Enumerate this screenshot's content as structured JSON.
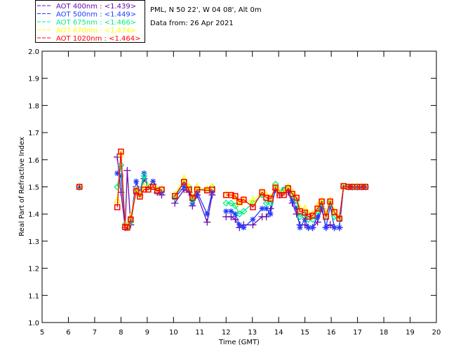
{
  "header": {
    "site_line": "PML, N 50 22', W 04 08', Alt 0m",
    "date_line": "Data from: 26 Apr 2021"
  },
  "chart_data": {
    "type": "line",
    "title": "",
    "xlabel": "Time (GMT)",
    "ylabel": "Real Part of Refractive Index",
    "xlim": [
      5,
      20
    ],
    "ylim": [
      1.0,
      2.0
    ],
    "xticks": [
      "5",
      "6",
      "7",
      "8",
      "9",
      "10",
      "11",
      "12",
      "13",
      "14",
      "15",
      "16",
      "17",
      "18",
      "19",
      "20"
    ],
    "yticks": [
      "1.0",
      "1.1",
      "1.2",
      "1.3",
      "1.4",
      "1.5",
      "1.6",
      "1.7",
      "1.8",
      "1.9",
      "2.0"
    ],
    "grid": false,
    "legend_placement": "top-left outside",
    "x": [
      6.42,
      7.86,
      8.0,
      8.16,
      8.24,
      8.37,
      8.58,
      8.72,
      8.88,
      9.04,
      9.22,
      9.38,
      9.55,
      10.05,
      10.4,
      10.59,
      10.72,
      10.9,
      11.28,
      11.47,
      12.0,
      12.19,
      12.35,
      12.51,
      12.67,
      13.02,
      13.37,
      13.53,
      13.69,
      13.88,
      14.04,
      14.2,
      14.36,
      14.52,
      14.68,
      14.81,
      15.0,
      15.13,
      15.29,
      15.48,
      15.64,
      15.8,
      15.96,
      16.12,
      16.31,
      16.47,
      16.66,
      16.8,
      16.99,
      17.16,
      17.3
    ],
    "series": [
      {
        "name": "AOT  400nm",
        "mean": "<1.439>",
        "color": "#6a0dad",
        "marker": "plus",
        "values": [
          1.5,
          1.61,
          1.48,
          1.35,
          1.56,
          1.36,
          1.5,
          1.47,
          1.53,
          1.5,
          1.51,
          1.48,
          1.47,
          1.44,
          1.49,
          1.48,
          1.43,
          1.47,
          1.37,
          1.47,
          1.39,
          1.39,
          1.38,
          1.35,
          1.36,
          1.36,
          1.39,
          1.39,
          1.42,
          1.49,
          1.47,
          1.48,
          1.48,
          1.44,
          1.4,
          1.36,
          1.36,
          1.35,
          1.35,
          1.37,
          1.42,
          1.35,
          1.36,
          1.35,
          1.35,
          1.5,
          1.5,
          1.5,
          1.5,
          1.5,
          1.5
        ]
      },
      {
        "name": "AOT  500nm",
        "mean": "<1.449>",
        "color": "#1e3cff",
        "marker": "asterisk",
        "values": [
          1.5,
          1.55,
          1.54,
          1.36,
          1.35,
          1.38,
          1.52,
          1.48,
          1.55,
          1.5,
          1.52,
          1.49,
          1.48,
          1.46,
          1.5,
          1.49,
          1.44,
          1.48,
          1.4,
          1.48,
          1.41,
          1.41,
          1.4,
          1.36,
          1.35,
          1.38,
          1.42,
          1.42,
          1.4,
          1.5,
          1.48,
          1.49,
          1.49,
          1.45,
          1.42,
          1.35,
          1.38,
          1.35,
          1.35,
          1.39,
          1.43,
          1.35,
          1.43,
          1.35,
          1.35,
          1.5,
          1.5,
          1.5,
          1.5,
          1.5,
          1.5
        ]
      },
      {
        "name": "AOT  675nm",
        "mean": "<1.466>",
        "color": "#00f080",
        "marker": "diamond",
        "values": [
          1.5,
          1.5,
          1.58,
          1.36,
          1.35,
          1.37,
          1.49,
          1.47,
          1.54,
          1.5,
          1.5,
          1.49,
          1.49,
          1.46,
          1.52,
          1.5,
          1.45,
          1.49,
          1.49,
          1.5,
          1.44,
          1.44,
          1.43,
          1.4,
          1.41,
          1.44,
          1.47,
          1.44,
          1.44,
          1.51,
          1.48,
          1.49,
          1.5,
          1.47,
          1.45,
          1.39,
          1.4,
          1.38,
          1.38,
          1.41,
          1.44,
          1.39,
          1.44,
          1.39,
          1.38,
          1.5,
          1.5,
          1.5,
          1.5,
          1.5,
          1.5
        ]
      },
      {
        "name": "AOT  870nm",
        "mean": "<1.474>",
        "color": "#ffff00",
        "marker": "triangle",
        "values": [
          1.5,
          1.45,
          1.62,
          1.36,
          1.35,
          1.39,
          1.49,
          1.47,
          1.5,
          1.5,
          1.5,
          1.49,
          1.49,
          1.47,
          1.53,
          1.5,
          1.46,
          1.5,
          1.49,
          1.5,
          1.47,
          1.47,
          1.46,
          1.44,
          1.45,
          1.45,
          1.48,
          1.47,
          1.46,
          1.5,
          1.48,
          1.48,
          1.5,
          1.48,
          1.46,
          1.42,
          1.42,
          1.4,
          1.4,
          1.43,
          1.45,
          1.4,
          1.45,
          1.41,
          1.39,
          1.5,
          1.5,
          1.5,
          1.5,
          1.5,
          1.5
        ]
      },
      {
        "name": "AOT 1020nm",
        "mean": "<1.464>",
        "color": "#ff0000",
        "marker": "square",
        "values": [
          1.5,
          1.425,
          1.63,
          1.352,
          1.35,
          1.38,
          1.484,
          1.464,
          1.49,
          1.49,
          1.5,
          1.484,
          1.49,
          1.466,
          1.518,
          1.49,
          1.46,
          1.49,
          1.487,
          1.49,
          1.47,
          1.47,
          1.466,
          1.445,
          1.453,
          1.425,
          1.48,
          1.46,
          1.456,
          1.497,
          1.47,
          1.47,
          1.495,
          1.474,
          1.46,
          1.41,
          1.405,
          1.39,
          1.394,
          1.42,
          1.446,
          1.39,
          1.446,
          1.407,
          1.383,
          1.503,
          1.5,
          1.5,
          1.5,
          1.5,
          1.5
        ]
      }
    ]
  }
}
